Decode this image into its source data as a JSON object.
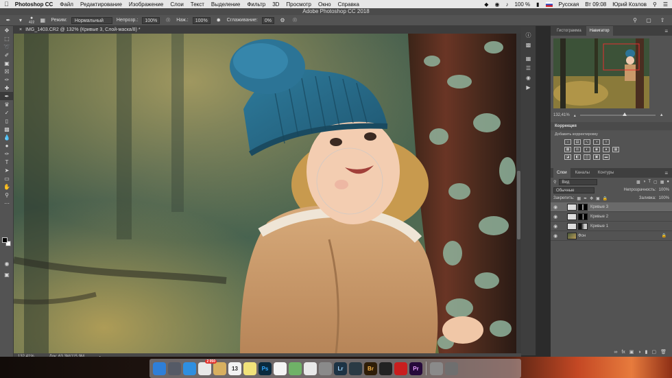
{
  "menubar": {
    "app": "Photoshop CC",
    "items": [
      "Файл",
      "Редактирование",
      "Изображение",
      "Слои",
      "Текст",
      "Выделение",
      "Фильтр",
      "3D",
      "Просмотр",
      "Окно",
      "Справка"
    ],
    "battery": "100 %",
    "language": "Русская",
    "clock": "Вт 09:08",
    "user": "Юрий Козлов"
  },
  "window": {
    "title": "Adobe Photoshop CC 2018"
  },
  "options": {
    "brush_size": "422",
    "mode_label": "Режим:",
    "mode_value": "Нормальный",
    "opacity_label": "Непрозр.:",
    "opacity_value": "100%",
    "flow_label": "Наж.:",
    "flow_value": "100%",
    "smoothing_label": "Сглаживание:",
    "smoothing_value": "0%"
  },
  "document": {
    "tab": "IMG_1403.CR2 @ 132% (Кривые 3, Слой-маска/8) *",
    "zoom": "132,41%",
    "doc_size": "Док: 63,3М/115,9М"
  },
  "navigator": {
    "tabs": [
      "Гистограмма",
      "Навигатор"
    ],
    "active_tab": "Навигатор",
    "zoom": "132,41%"
  },
  "correction": {
    "title": "Коррекция",
    "subtitle": "Добавить корректировку"
  },
  "layers": {
    "tabs": [
      "Слои",
      "Каналы",
      "Контуры"
    ],
    "filter": "Вид",
    "blend_mode": "Обычные",
    "opacity_label": "Непрозрачность:",
    "opacity_value": "100%",
    "lock_label": "Закрепить:",
    "fill_label": "Заливка:",
    "fill_value": "100%",
    "items": [
      {
        "name": "Кривые 3",
        "selected": true
      },
      {
        "name": "Кривые 2",
        "selected": false
      },
      {
        "name": "Кривые 1",
        "selected": false
      },
      {
        "name": "Фон",
        "selected": false
      }
    ]
  },
  "dock": {
    "chrome_badge": "2 050",
    "calendar_day": "13",
    "apps": [
      {
        "icon": "finder-icon",
        "label": "",
        "color": "#2f7fd8"
      },
      {
        "icon": "launchpad-icon",
        "label": "",
        "color": "#555a66"
      },
      {
        "icon": "safari-icon",
        "label": "",
        "color": "#2f8fe0"
      },
      {
        "icon": "chrome-icon",
        "label": "",
        "color": "#e8e8e8"
      },
      {
        "icon": "notes-icon",
        "label": "",
        "color": "#d8b060"
      },
      {
        "icon": "calendar-icon",
        "label": "13",
        "color": "#f2f2f2"
      },
      {
        "icon": "stickies-icon",
        "label": "",
        "color": "#f1e27a"
      },
      {
        "icon": "photoshop-icon",
        "label": "Ps",
        "color": "#0a2a3e"
      },
      {
        "icon": "reminders-icon",
        "label": "",
        "color": "#f4f4f4"
      },
      {
        "icon": "maps-icon",
        "label": "",
        "color": "#6fb267"
      },
      {
        "icon": "itunes-icon",
        "label": "",
        "color": "#e8e8e8"
      },
      {
        "icon": "system-prefs-icon",
        "label": "",
        "color": "#8a8a8a"
      },
      {
        "icon": "lightroom-icon",
        "label": "Lr",
        "color": "#1d3344"
      },
      {
        "icon": "camera-raw-icon",
        "label": "",
        "color": "#2a3a44"
      },
      {
        "icon": "bridge-icon",
        "label": "Br",
        "color": "#2e1d08"
      },
      {
        "icon": "capture-icon",
        "label": "",
        "color": "#222"
      },
      {
        "icon": "acrobat-icon",
        "label": "",
        "color": "#c81e1e"
      },
      {
        "icon": "premiere-icon",
        "label": "Pr",
        "color": "#260a3a"
      }
    ]
  }
}
